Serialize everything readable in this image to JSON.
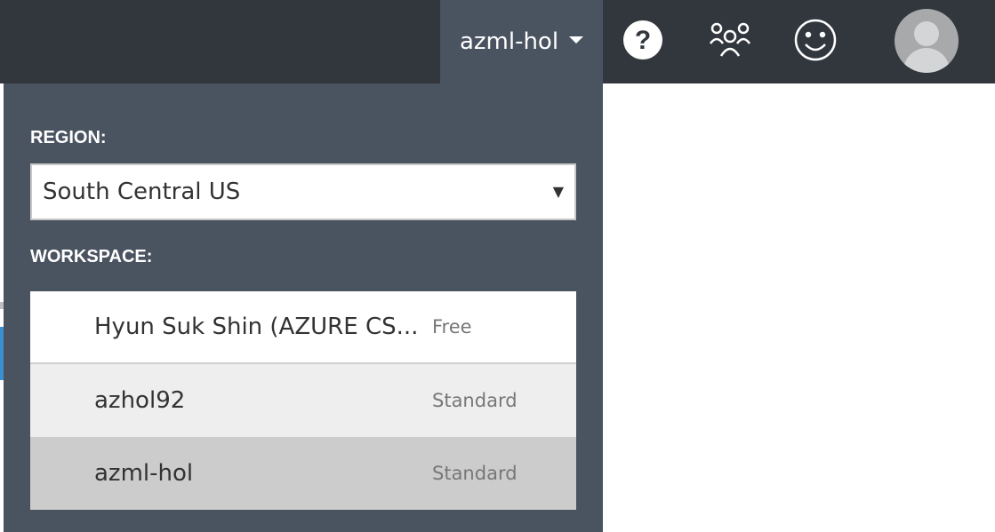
{
  "header": {
    "workspace_switcher_label": "azml-hol",
    "icons": [
      "help-icon",
      "people-icon",
      "smile-icon",
      "user-avatar"
    ]
  },
  "panel": {
    "region_label": "REGION:",
    "region_value": "South Central US",
    "workspace_label": "WORKSPACE:",
    "workspaces": [
      {
        "name": "Hyun Suk Shin (AZURE CS...",
        "tier": "Free"
      },
      {
        "name": "azhol92",
        "tier": "Standard"
      },
      {
        "name": "azml-hol",
        "tier": "Standard"
      }
    ]
  },
  "colors": {
    "topbar": "#32373e",
    "panel": "#4a5360",
    "selected_row": "#cccccc"
  }
}
